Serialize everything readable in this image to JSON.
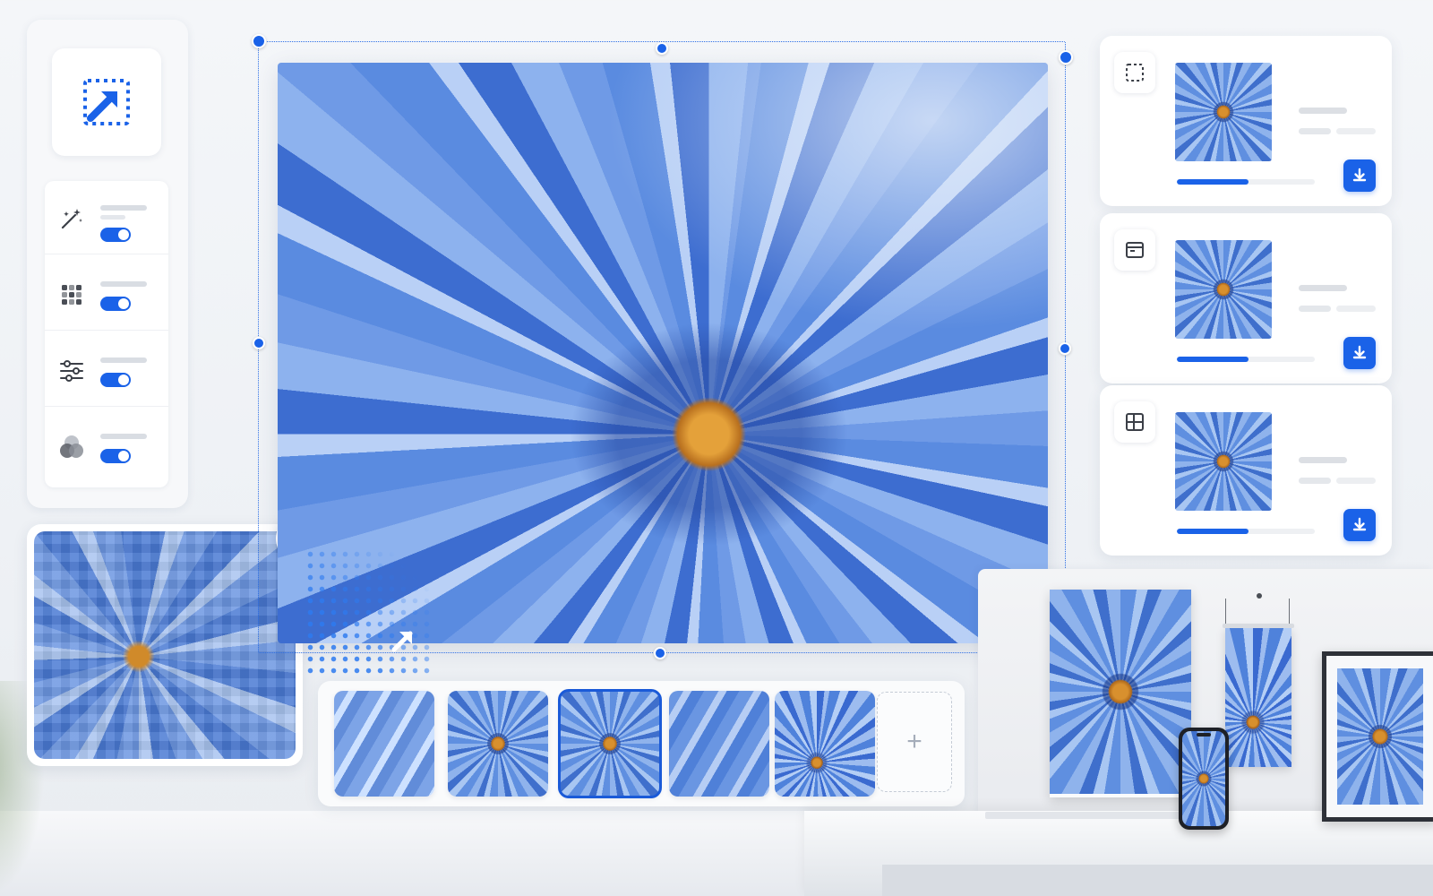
{
  "app": {
    "name": ""
  },
  "tool_rail": {
    "main_tool": {
      "icon": "expand-selection-icon",
      "active": true
    },
    "tools": [
      {
        "icon": "magic-wand-icon",
        "enabled": true
      },
      {
        "icon": "pixel-grid-icon",
        "enabled": true
      },
      {
        "icon": "sliders-icon",
        "enabled": true
      },
      {
        "icon": "color-blend-icon",
        "enabled": true
      }
    ]
  },
  "pixel_preview": {
    "badge_icon": "grid-icon"
  },
  "canvas": {
    "selection_handles": 6
  },
  "thumbnails": {
    "items": [
      {
        "style": "pixelated"
      },
      {
        "style": "full-bloom"
      },
      {
        "style": "full-bloom",
        "selected": true
      },
      {
        "style": "petals-closeup"
      },
      {
        "style": "corner-crop"
      }
    ],
    "add_label": "+"
  },
  "export_cards": [
    {
      "format_icon": "crop-square-icon",
      "progress": 0.52,
      "action_icon": "download-icon"
    },
    {
      "format_icon": "web-layout-icon",
      "progress": 0.52,
      "action_icon": "download-icon"
    },
    {
      "format_icon": "grid-layout-icon",
      "progress": 0.52,
      "action_icon": "download-icon"
    }
  ],
  "mockups": [
    "poster",
    "hanging-banner",
    "framed-print",
    "phone-screen"
  ],
  "colors": {
    "accent": "#1a62e8",
    "panel": "#ffffff",
    "background": "#f0f2f5",
    "flower_center": "#d8902e"
  }
}
